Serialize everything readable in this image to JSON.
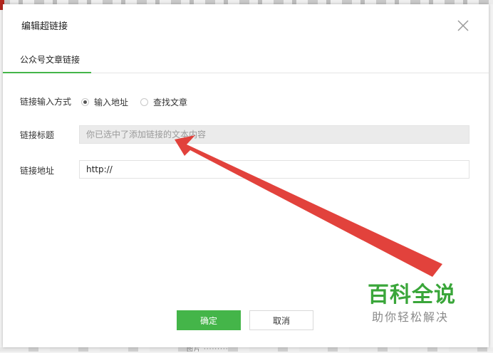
{
  "dialog": {
    "title": "编辑超链接",
    "close_icon": "close-icon"
  },
  "tabs": [
    {
      "label": "公众号文章链接",
      "active": true
    }
  ],
  "form": {
    "method_label": "链接输入方式",
    "options": [
      {
        "label": "输入地址",
        "selected": true
      },
      {
        "label": "查找文章",
        "selected": false
      }
    ],
    "title_label": "链接标题",
    "title_placeholder": "你已选中了添加链接的文本内容",
    "url_label": "链接地址",
    "url_value": "http://"
  },
  "buttons": {
    "confirm": "确定",
    "cancel": "取消"
  },
  "background": {
    "bottom_text": "图片 ·········"
  },
  "watermark": {
    "title": "百科全说",
    "subtitle": "助你轻松解决"
  },
  "colors": {
    "accent": "#44b549",
    "arrow": "#e0322b",
    "watermark": "#3aa63a"
  }
}
